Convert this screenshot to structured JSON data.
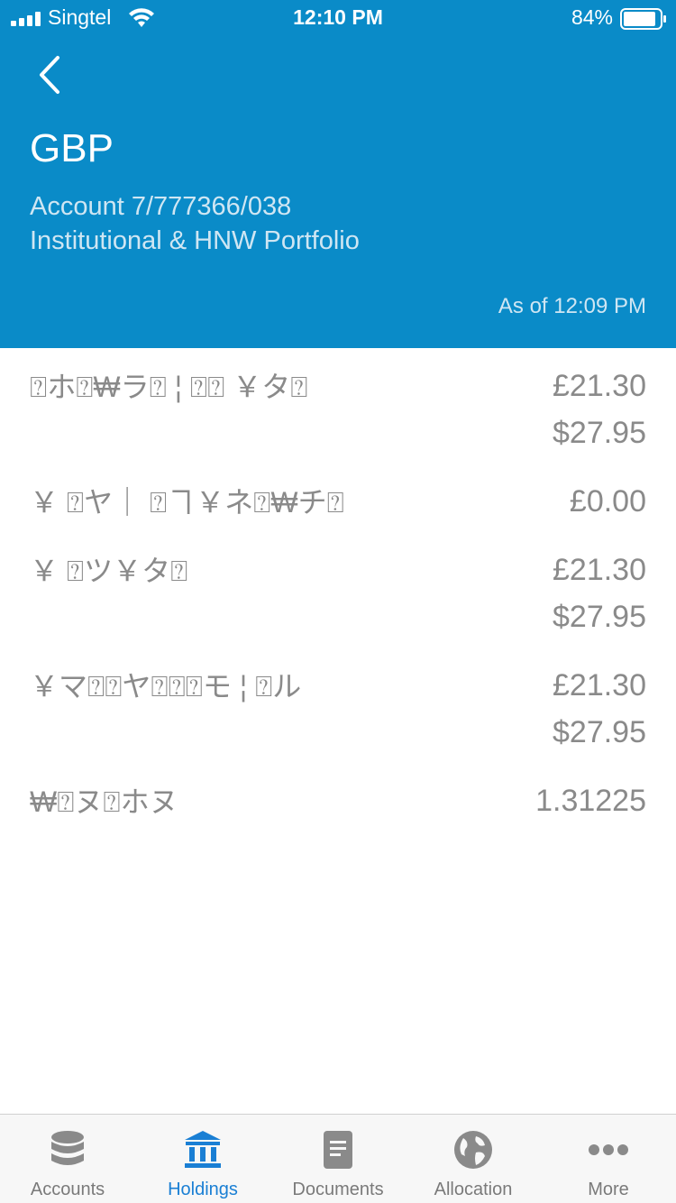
{
  "status_bar": {
    "carrier": "Singtel",
    "time": "12:10 PM",
    "battery": "84%"
  },
  "header": {
    "title": "GBP",
    "account": "Account 7/777366/038",
    "portfolio": "Institutional & HNW Portfolio",
    "as_of": "As of 12:09 PM"
  },
  "rows": [
    {
      "label": "⍰ホ⍰₩ラ⍰ ¦ ⍰⍰ ￥タ⍰",
      "values": [
        "£21.30",
        "$27.95"
      ]
    },
    {
      "label": "￥ ⍰ヤ｜ ⍰ヿ￥ネ⍰₩チ⍰",
      "values": [
        "£0.00"
      ]
    },
    {
      "label": "￥ ⍰ツ￥タ⍰",
      "values": [
        "£21.30",
        "$27.95"
      ]
    },
    {
      "label": "￥マ⍰⍰ヤ⍰⍰⍰モ ¦ ⍰ル",
      "values": [
        "£21.30",
        "$27.95"
      ]
    },
    {
      "label": "₩⍰ヌ⍰ホヌ",
      "values": [
        "1.31225"
      ]
    }
  ],
  "tabs": [
    {
      "label": "Accounts",
      "icon": "database-icon",
      "active": false
    },
    {
      "label": "Holdings",
      "icon": "bank-icon",
      "active": true
    },
    {
      "label": "Documents",
      "icon": "document-icon",
      "active": false
    },
    {
      "label": "Allocation",
      "icon": "globe-icon",
      "active": false
    },
    {
      "label": "More",
      "icon": "more-dots-icon",
      "active": false
    }
  ],
  "colors": {
    "header_bg": "#0a8bc8",
    "active_tab": "#1a7fd4",
    "inactive_tab": "#7a7a7a"
  }
}
